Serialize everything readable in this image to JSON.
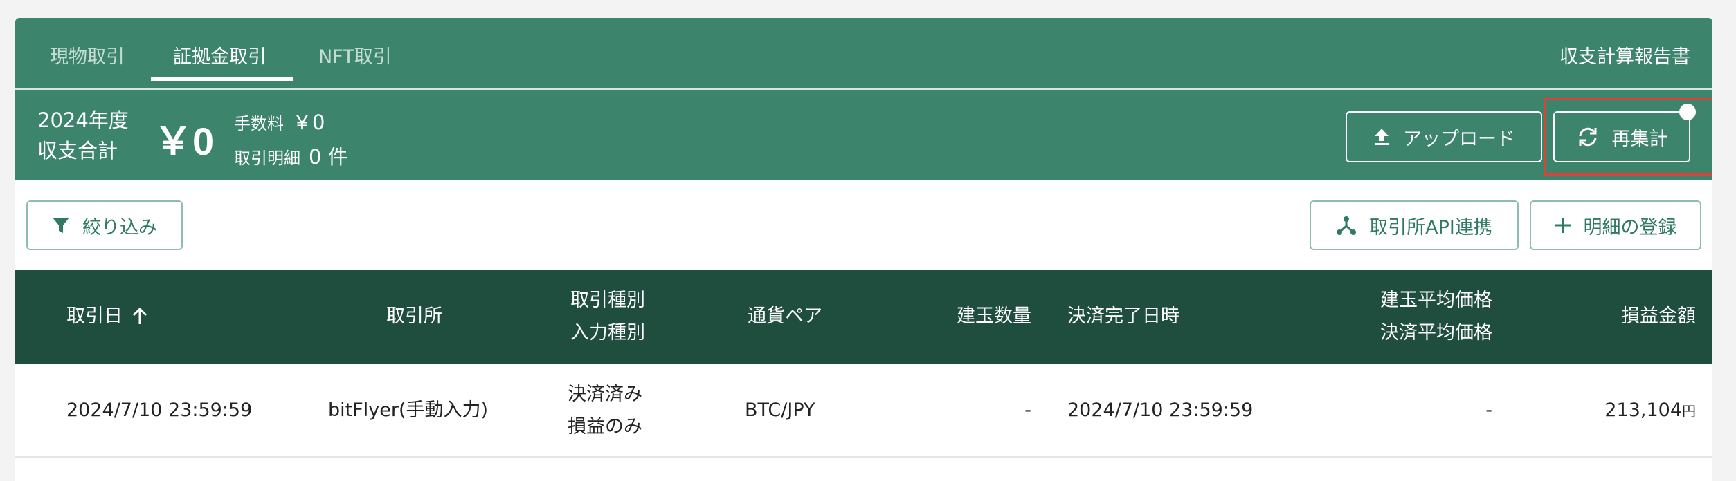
{
  "tabs": [
    {
      "label": "現物取引",
      "active": false
    },
    {
      "label": "証拠金取引",
      "active": true
    },
    {
      "label": "NFT取引",
      "active": false
    }
  ],
  "header": {
    "report_link": "収支計算報告書",
    "year_label_line1": "2024年度",
    "year_label_line2": "収支合計",
    "total_amount": "￥0",
    "fee_label": "手数料",
    "fee_value": "￥0",
    "count_label": "取引明細",
    "count_value": "0 件",
    "upload_label": "アップロード",
    "recalc_label": "再集計"
  },
  "toolbar": {
    "filter_label": "絞り込み",
    "api_label": "取引所API連携",
    "register_label": "明細の登録"
  },
  "table": {
    "headers": {
      "date": "取引日",
      "exchange": "取引所",
      "type_line1": "取引種別",
      "type_line2": "入力種別",
      "pair": "通貨ペア",
      "quantity": "建玉数量",
      "settled": "決済完了日時",
      "price_line1": "建玉平均価格",
      "price_line2": "決済平均価格",
      "pnl": "損益金額"
    },
    "rows": [
      {
        "date": "2024/7/10 23:59:59",
        "exchange": "bitFlyer(手動入力)",
        "type_line1": "決済済み",
        "type_line2": "損益のみ",
        "pair": "BTC/JPY",
        "quantity": "-",
        "settled": "2024/7/10 23:59:59",
        "price": "-",
        "pnl": "213,104",
        "pnl_unit": "円"
      }
    ]
  },
  "colors": {
    "header_green": "#3d846c",
    "table_head": "#1f4d3e",
    "accent_text": "#2f7a60",
    "highlight": "#d9443a"
  },
  "icons": {
    "upload": "upload-icon",
    "recalc": "refresh-icon",
    "filter": "filter-icon",
    "api": "network-icon",
    "register": "plus-icon",
    "sort": "arrow-up-icon"
  }
}
